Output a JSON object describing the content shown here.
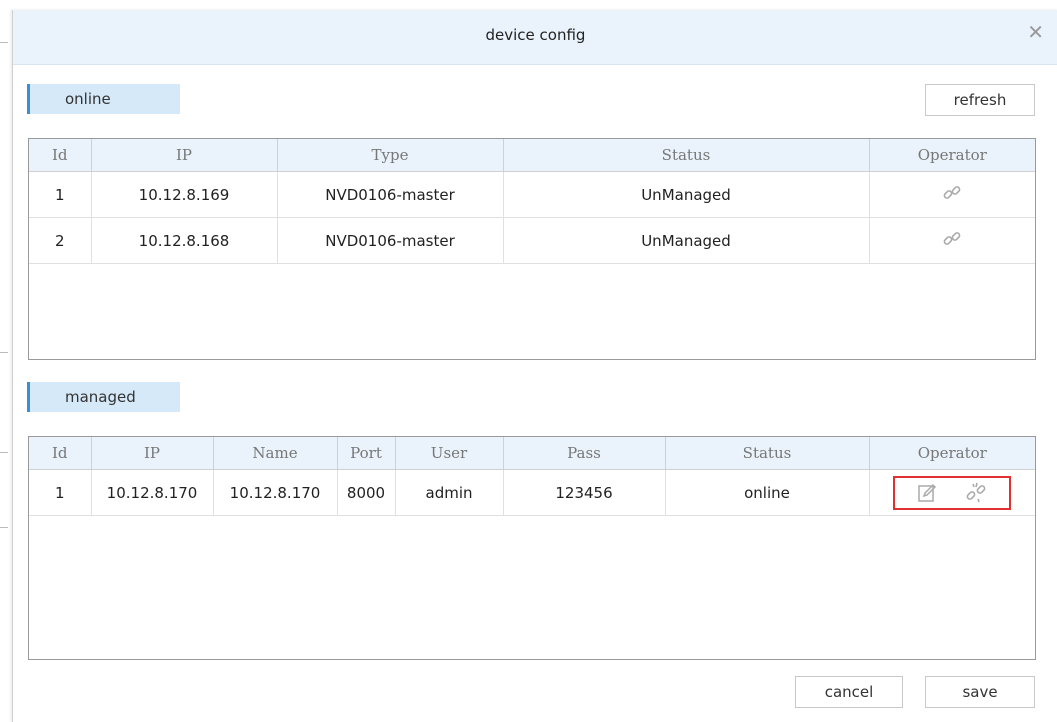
{
  "dialog": {
    "title": "device config",
    "close_icon": "close-icon"
  },
  "online": {
    "section_label": "online",
    "refresh_label": "refresh",
    "columns": [
      "Id",
      "IP",
      "Type",
      "Status",
      "Operator"
    ],
    "rows": [
      {
        "id": "1",
        "ip": "10.12.8.169",
        "type": "NVD0106-master",
        "status": "UnManaged",
        "operator_icon": "link-icon"
      },
      {
        "id": "2",
        "ip": "10.12.8.168",
        "type": "NVD0106-master",
        "status": "UnManaged",
        "operator_icon": "link-icon"
      }
    ]
  },
  "managed": {
    "section_label": "managed",
    "columns": [
      "Id",
      "IP",
      "Name",
      "Port",
      "User",
      "Pass",
      "Status",
      "Operator"
    ],
    "rows": [
      {
        "id": "1",
        "ip": "10.12.8.170",
        "name": "10.12.8.170",
        "port": "8000",
        "user": "admin",
        "pass": "123456",
        "status": "online",
        "operator_icons": [
          "edit-icon",
          "unlink-icon"
        ]
      }
    ],
    "highlight_color": "#e03030"
  },
  "footer": {
    "cancel_label": "cancel",
    "save_label": "save"
  },
  "colors": {
    "header_bg": "#eaf3fb",
    "tab_bg": "#d6e9f8",
    "tab_accent": "#3b8ed8"
  }
}
